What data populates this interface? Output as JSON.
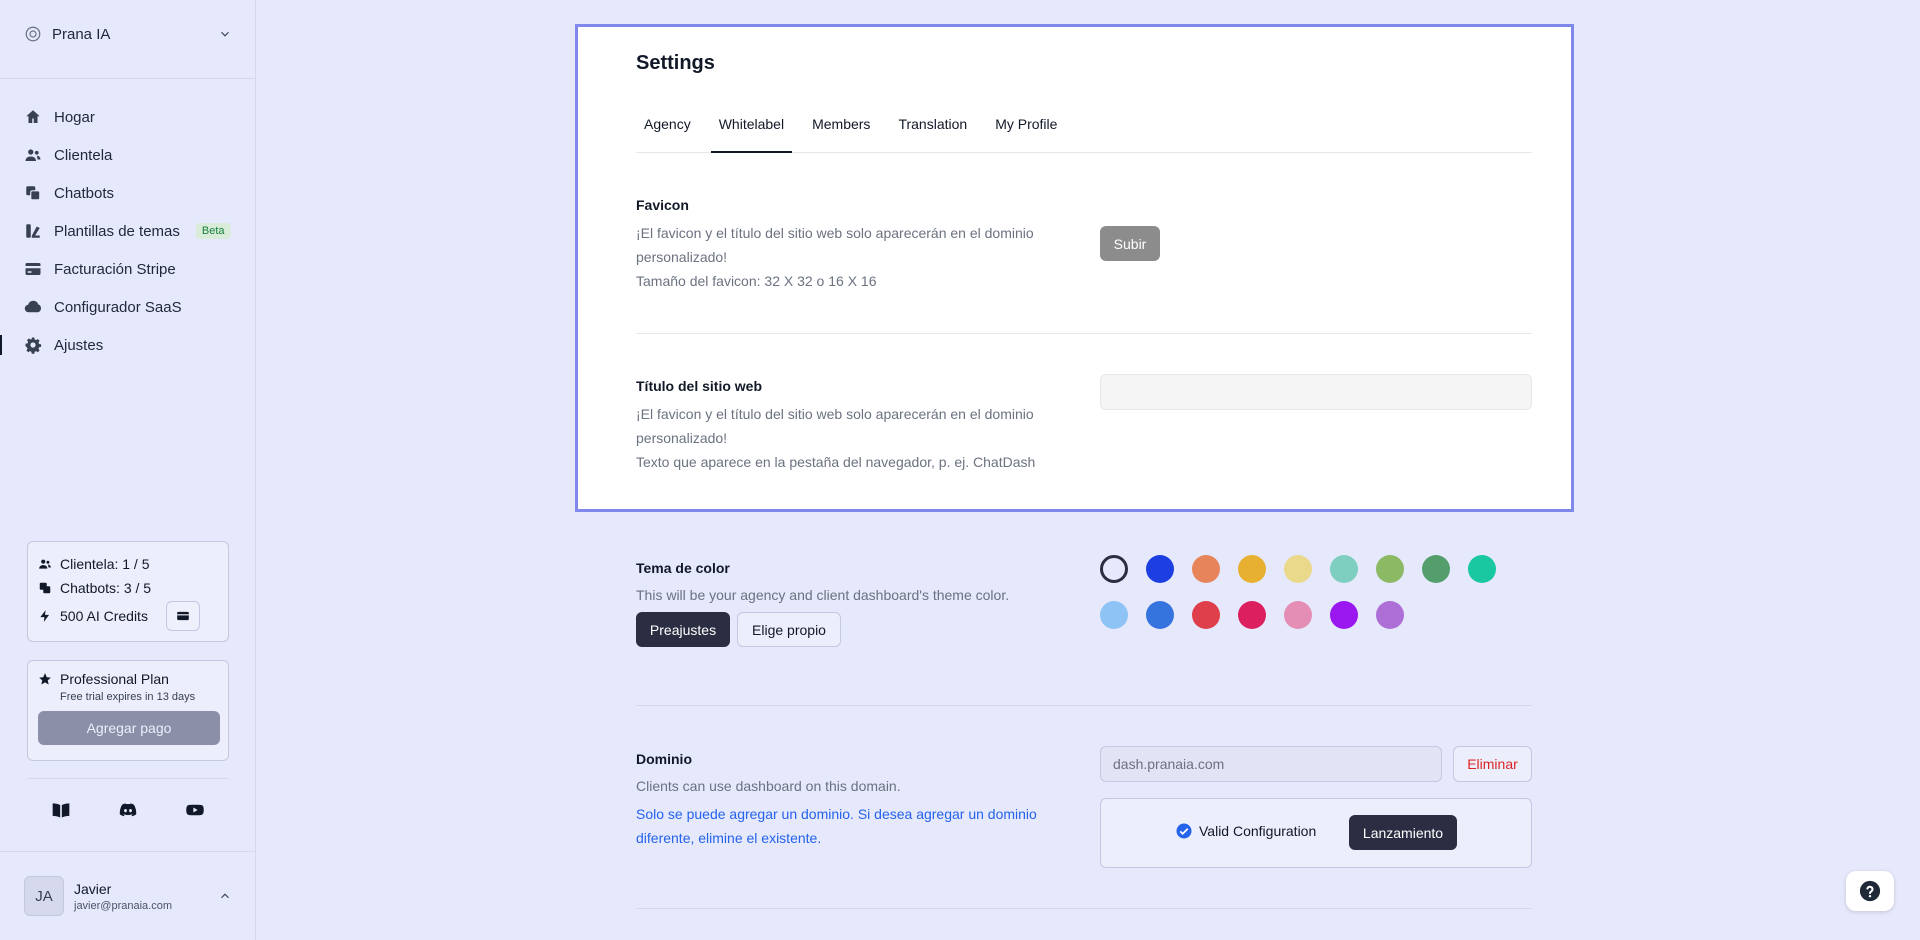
{
  "workspace": {
    "name": "Prana IA"
  },
  "nav": {
    "items": [
      {
        "label": "Hogar"
      },
      {
        "label": "Clientela"
      },
      {
        "label": "Chatbots"
      },
      {
        "label": "Plantillas de temas",
        "badge": "Beta"
      },
      {
        "label": "Facturación Stripe"
      },
      {
        "label": "Configurador SaaS"
      },
      {
        "label": "Ajustes"
      }
    ]
  },
  "usage": {
    "clients": "Clientela: 1 / 5",
    "chatbots": "Chatbots: 3 / 5",
    "credits": "500 AI Credits"
  },
  "plan": {
    "title": "Professional Plan",
    "subtitle": "Free trial expires in 13 days",
    "button": "Agregar pago"
  },
  "user": {
    "initials": "JA",
    "name": "Javier",
    "email": "javier@pranaia.com"
  },
  "settings": {
    "title": "Settings",
    "tabs": [
      "Agency",
      "Whitelabel",
      "Members",
      "Translation",
      "My Profile"
    ],
    "active_tab": "Whitelabel"
  },
  "favicon": {
    "label": "Favicon",
    "desc1": "¡El favicon y el título del sitio web solo aparecerán en el dominio personalizado!",
    "desc2": "Tamaño del favicon: 32 X 32 o 16 X 16",
    "button": "Subir"
  },
  "site_title": {
    "label": "Título del sitio web",
    "desc1": "¡El favicon y el título del sitio web solo aparecerán en el dominio personalizado!",
    "desc2": "Texto que aparece en la pestaña del navegador, p. ej. ChatDash",
    "value": ""
  },
  "color_theme": {
    "label": "Tema de color",
    "desc": "This will be your agency and client dashboard's theme color.",
    "presets_button": "Preajustes",
    "custom_button": "Elige propio",
    "colors": [
      "#ffffff",
      "#1d3ee0",
      "#e8845a",
      "#e8b030",
      "#ead98a",
      "#7ecfc0",
      "#8cb964",
      "#549e6c",
      "#19c7a0",
      "#8ec4f5",
      "#3573de",
      "#de3f4a",
      "#dc1f5e",
      "#e48db5",
      "#9b17f0",
      "#ad6fd6"
    ]
  },
  "domain": {
    "label": "Dominio",
    "desc": "Clients can use dashboard on this domain.",
    "note": "Solo se puede agregar un dominio. Si desea agregar un dominio diferente, elimine el existente.",
    "value": "dash.pranaia.com",
    "delete_button": "Eliminar",
    "valid_text": "Valid Configuration",
    "launch_button": "Lanzamiento"
  }
}
